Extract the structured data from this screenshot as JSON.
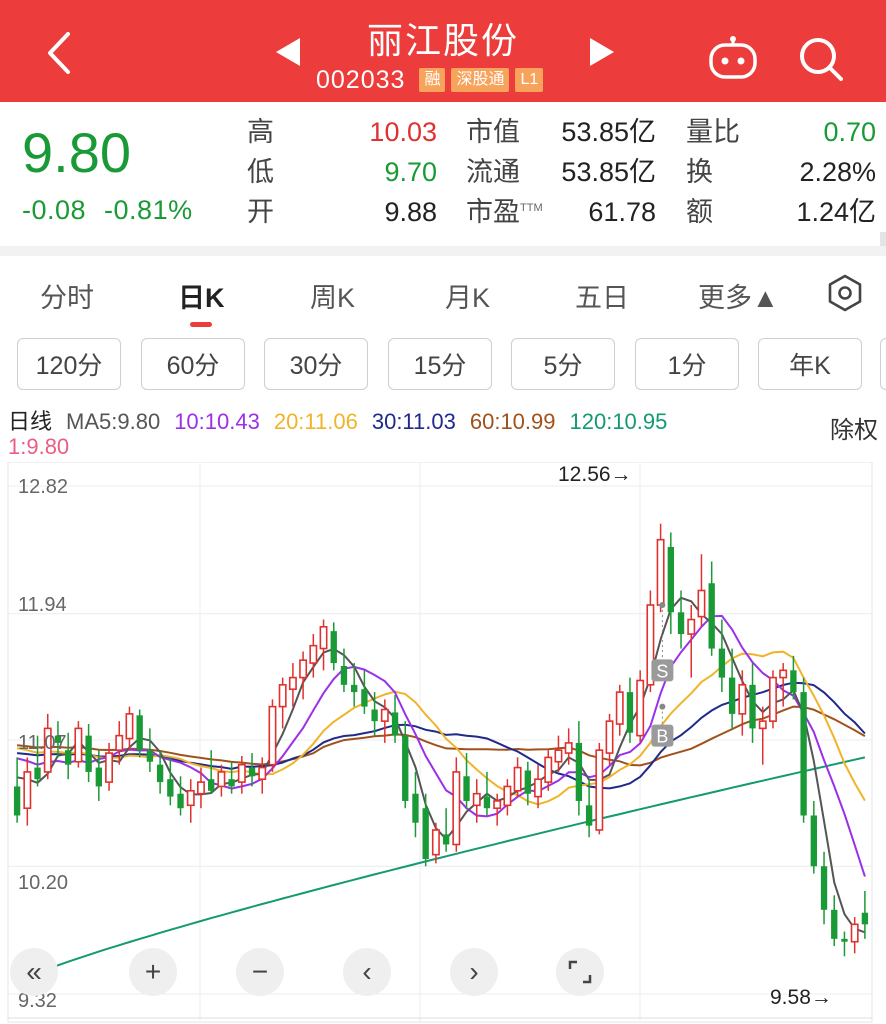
{
  "header": {
    "title": "丽江股份",
    "code": "002033",
    "tags": [
      "融",
      "深股通",
      "L1"
    ]
  },
  "quote": {
    "price": "9.80",
    "change": "-0.08",
    "change_pct": "-0.81%",
    "stats": {
      "high_label": "高",
      "high": "10.03",
      "low_label": "低",
      "low": "9.70",
      "open_label": "开",
      "open": "9.88",
      "mktcap_label": "市值",
      "mktcap": "53.85亿",
      "float_label": "流通",
      "float": "53.85亿",
      "pe_label": "市盈",
      "pe_sup": "TTM",
      "pe": "61.78",
      "volratio_label": "量比",
      "volratio": "0.70",
      "turnover_label": "换",
      "turnover": "2.28%",
      "amount_label": "额",
      "amount": "1.24亿"
    }
  },
  "tabs": [
    "分时",
    "日K",
    "周K",
    "月K",
    "五日",
    "更多▲"
  ],
  "periods": [
    "120分",
    "60分",
    "30分",
    "15分",
    "5分",
    "1分",
    "年K"
  ],
  "ma_legend": {
    "label": "日线",
    "ma5": "MA5:9.80",
    "ma10": "10:10.43",
    "ma20": "20:11.06",
    "ma30": "30:11.03",
    "ma60": "60:10.99",
    "ma120": "120:10.95",
    "ma1": "1:9.80",
    "fuquan": "除权"
  },
  "colors": {
    "header": "#ec3c3c",
    "up": "#e0312f",
    "down": "#1a9a36",
    "ma5": "#555555",
    "ma10": "#9b30e8",
    "ma20": "#f0b429",
    "ma30": "#1f2a8a",
    "ma60": "#a0521c",
    "ma120": "#139a72"
  },
  "chart_data": {
    "type": "candlestick",
    "y_ticks": [
      "12.82",
      "11.94",
      "11.07",
      "10.20",
      "9.32"
    ],
    "ylim": [
      9.32,
      12.82
    ],
    "annotations": {
      "high": "12.56→",
      "low": "9.58→"
    },
    "markers": [
      "S",
      "B"
    ],
    "candles": [
      [
        10.75,
        10.95,
        10.5,
        10.55
      ],
      [
        10.6,
        10.95,
        10.48,
        10.85
      ],
      [
        10.88,
        11.1,
        10.75,
        10.8
      ],
      [
        10.85,
        11.25,
        10.8,
        11.15
      ],
      [
        11.1,
        11.2,
        10.95,
        11.05
      ],
      [
        11.0,
        11.12,
        10.8,
        10.9
      ],
      [
        10.92,
        11.2,
        10.88,
        11.15
      ],
      [
        11.1,
        11.18,
        10.78,
        10.85
      ],
      [
        10.88,
        11.0,
        10.65,
        10.75
      ],
      [
        10.78,
        11.05,
        10.72,
        10.98
      ],
      [
        11.0,
        11.2,
        10.9,
        11.1
      ],
      [
        11.08,
        11.3,
        11.0,
        11.25
      ],
      [
        11.24,
        11.28,
        10.95,
        11.0
      ],
      [
        11.0,
        11.15,
        10.85,
        10.92
      ],
      [
        10.9,
        11.0,
        10.7,
        10.78
      ],
      [
        10.8,
        10.95,
        10.62,
        10.68
      ],
      [
        10.7,
        10.82,
        10.55,
        10.6
      ],
      [
        10.62,
        10.8,
        10.5,
        10.72
      ],
      [
        10.7,
        10.88,
        10.6,
        10.78
      ],
      [
        10.8,
        11.0,
        10.7,
        10.72
      ],
      [
        10.75,
        10.9,
        10.68,
        10.85
      ],
      [
        10.8,
        10.92,
        10.7,
        10.75
      ],
      [
        10.78,
        10.96,
        10.7,
        10.9
      ],
      [
        10.88,
        10.98,
        10.75,
        10.82
      ],
      [
        10.8,
        10.95,
        10.7,
        10.88
      ],
      [
        10.9,
        11.35,
        10.85,
        11.3
      ],
      [
        11.3,
        11.5,
        11.15,
        11.45
      ],
      [
        11.42,
        11.6,
        11.3,
        11.5
      ],
      [
        11.5,
        11.68,
        11.35,
        11.62
      ],
      [
        11.6,
        11.8,
        11.5,
        11.72
      ],
      [
        11.7,
        11.9,
        11.55,
        11.85
      ],
      [
        11.82,
        11.88,
        11.55,
        11.6
      ],
      [
        11.58,
        11.7,
        11.4,
        11.45
      ],
      [
        11.45,
        11.6,
        11.3,
        11.4
      ],
      [
        11.42,
        11.55,
        11.25,
        11.3
      ],
      [
        11.28,
        11.4,
        11.1,
        11.2
      ],
      [
        11.2,
        11.35,
        11.05,
        11.28
      ],
      [
        11.26,
        11.38,
        11.05,
        11.1
      ],
      [
        11.1,
        11.2,
        10.6,
        10.65
      ],
      [
        10.7,
        10.85,
        10.4,
        10.5
      ],
      [
        10.6,
        10.7,
        10.2,
        10.25
      ],
      [
        10.28,
        10.5,
        10.22,
        10.45
      ],
      [
        10.42,
        10.6,
        10.3,
        10.35
      ],
      [
        10.35,
        10.95,
        10.3,
        10.85
      ],
      [
        10.82,
        10.98,
        10.6,
        10.65
      ],
      [
        10.62,
        10.8,
        10.5,
        10.7
      ],
      [
        10.68,
        10.85,
        10.55,
        10.6
      ],
      [
        10.6,
        10.7,
        10.48,
        10.65
      ],
      [
        10.62,
        10.8,
        10.55,
        10.75
      ],
      [
        10.72,
        10.95,
        10.68,
        10.88
      ],
      [
        10.86,
        10.92,
        10.62,
        10.7
      ],
      [
        10.68,
        10.9,
        10.6,
        10.8
      ],
      [
        10.78,
        11.0,
        10.72,
        10.95
      ],
      [
        10.92,
        11.1,
        10.85,
        11.0
      ],
      [
        10.98,
        11.15,
        10.9,
        11.05
      ],
      [
        11.05,
        11.2,
        10.55,
        10.65
      ],
      [
        10.62,
        10.8,
        10.4,
        10.48
      ],
      [
        10.45,
        11.05,
        10.42,
        11.0
      ],
      [
        10.98,
        11.25,
        10.9,
        11.2
      ],
      [
        11.18,
        11.45,
        11.1,
        11.4
      ],
      [
        11.4,
        11.5,
        11.05,
        11.12
      ],
      [
        11.1,
        11.55,
        11.05,
        11.48
      ],
      [
        11.45,
        12.1,
        11.4,
        12.0
      ],
      [
        12.0,
        12.56,
        11.95,
        12.45
      ],
      [
        12.4,
        12.5,
        11.8,
        11.95
      ],
      [
        11.95,
        12.1,
        11.7,
        11.8
      ],
      [
        11.8,
        12.0,
        11.5,
        11.9
      ],
      [
        11.92,
        12.35,
        11.85,
        12.1
      ],
      [
        12.15,
        12.3,
        11.65,
        11.7
      ],
      [
        11.7,
        11.9,
        11.4,
        11.5
      ],
      [
        11.5,
        11.7,
        11.15,
        11.25
      ],
      [
        11.25,
        11.55,
        11.1,
        11.45
      ],
      [
        11.45,
        11.6,
        11.05,
        11.15
      ],
      [
        11.15,
        11.3,
        10.9,
        11.2
      ],
      [
        11.2,
        11.55,
        11.15,
        11.5
      ],
      [
        11.5,
        11.6,
        11.3,
        11.55
      ],
      [
        11.55,
        11.65,
        11.35,
        11.4
      ],
      [
        11.4,
        11.5,
        10.5,
        10.55
      ],
      [
        10.55,
        10.65,
        10.15,
        10.2
      ],
      [
        10.2,
        10.3,
        9.8,
        9.9
      ],
      [
        9.9,
        10.0,
        9.65,
        9.7
      ],
      [
        9.7,
        9.75,
        9.58,
        9.68
      ],
      [
        9.68,
        9.85,
        9.6,
        9.8
      ],
      [
        9.88,
        10.03,
        9.7,
        9.8
      ]
    ]
  }
}
